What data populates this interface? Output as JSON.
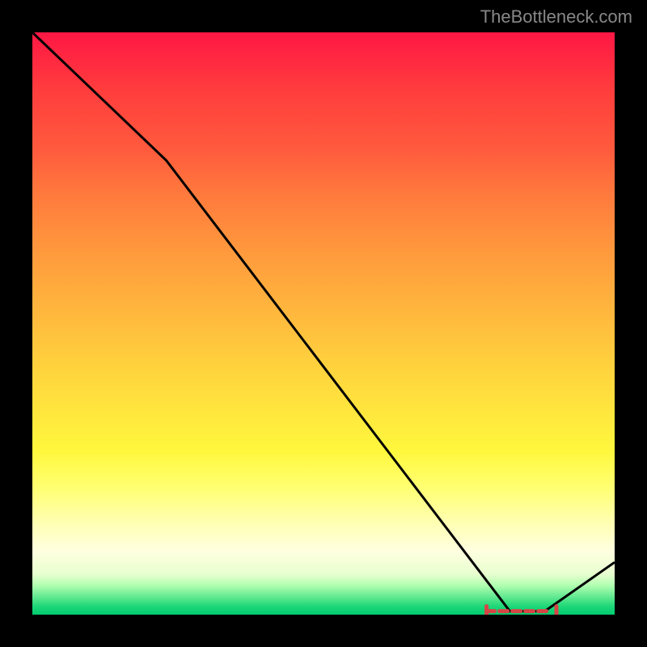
{
  "watermark": "TheBottleneck.com",
  "chart_data": {
    "type": "line",
    "title": "",
    "xlabel": "",
    "ylabel": "",
    "x": [
      0.0,
      0.23,
      0.82,
      0.88,
      1.0
    ],
    "y": [
      1.0,
      0.78,
      0.006,
      0.006,
      0.09
    ],
    "xlim": [
      0,
      1
    ],
    "ylim": [
      0,
      1
    ],
    "markers": {
      "x_range": [
        0.78,
        0.9
      ],
      "y": 0.006,
      "style": "dashed-red"
    }
  },
  "colors": {
    "line": "#000000",
    "marker": "#d64545",
    "bg_top": "#ff1744",
    "bg_bottom": "#00cc70",
    "frame": "#000000"
  }
}
